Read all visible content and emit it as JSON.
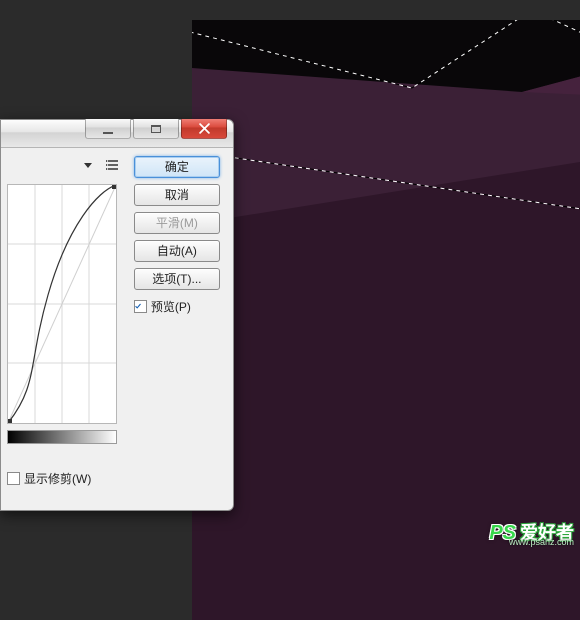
{
  "canvas": {
    "bg": "#2b2b2b",
    "doc_bg": "#090709",
    "shape_colors": [
      "#3b2036",
      "#2e1629",
      "#45223d"
    ]
  },
  "dialog": {
    "titlebar": {
      "close_icon": "close-icon",
      "maximize_icon": "maximize-icon",
      "minimize_icon": "minimize-icon"
    },
    "buttons": {
      "ok": "确定",
      "cancel": "取消",
      "smooth": "平滑(M)",
      "auto": "自动(A)",
      "options": "选项(T)..."
    },
    "checkboxes": {
      "preview": {
        "label": "预览(P)",
        "checked": true
      },
      "show_clipping": {
        "label": "显示修剪(W)",
        "checked": false
      }
    },
    "icons": {
      "preset_dropdown": "dropdown-caret-icon",
      "preset_menu": "preset-menu-icon"
    }
  },
  "watermark": {
    "logo": "PS",
    "text": "爱好者",
    "url": "www.psahz.com"
  }
}
